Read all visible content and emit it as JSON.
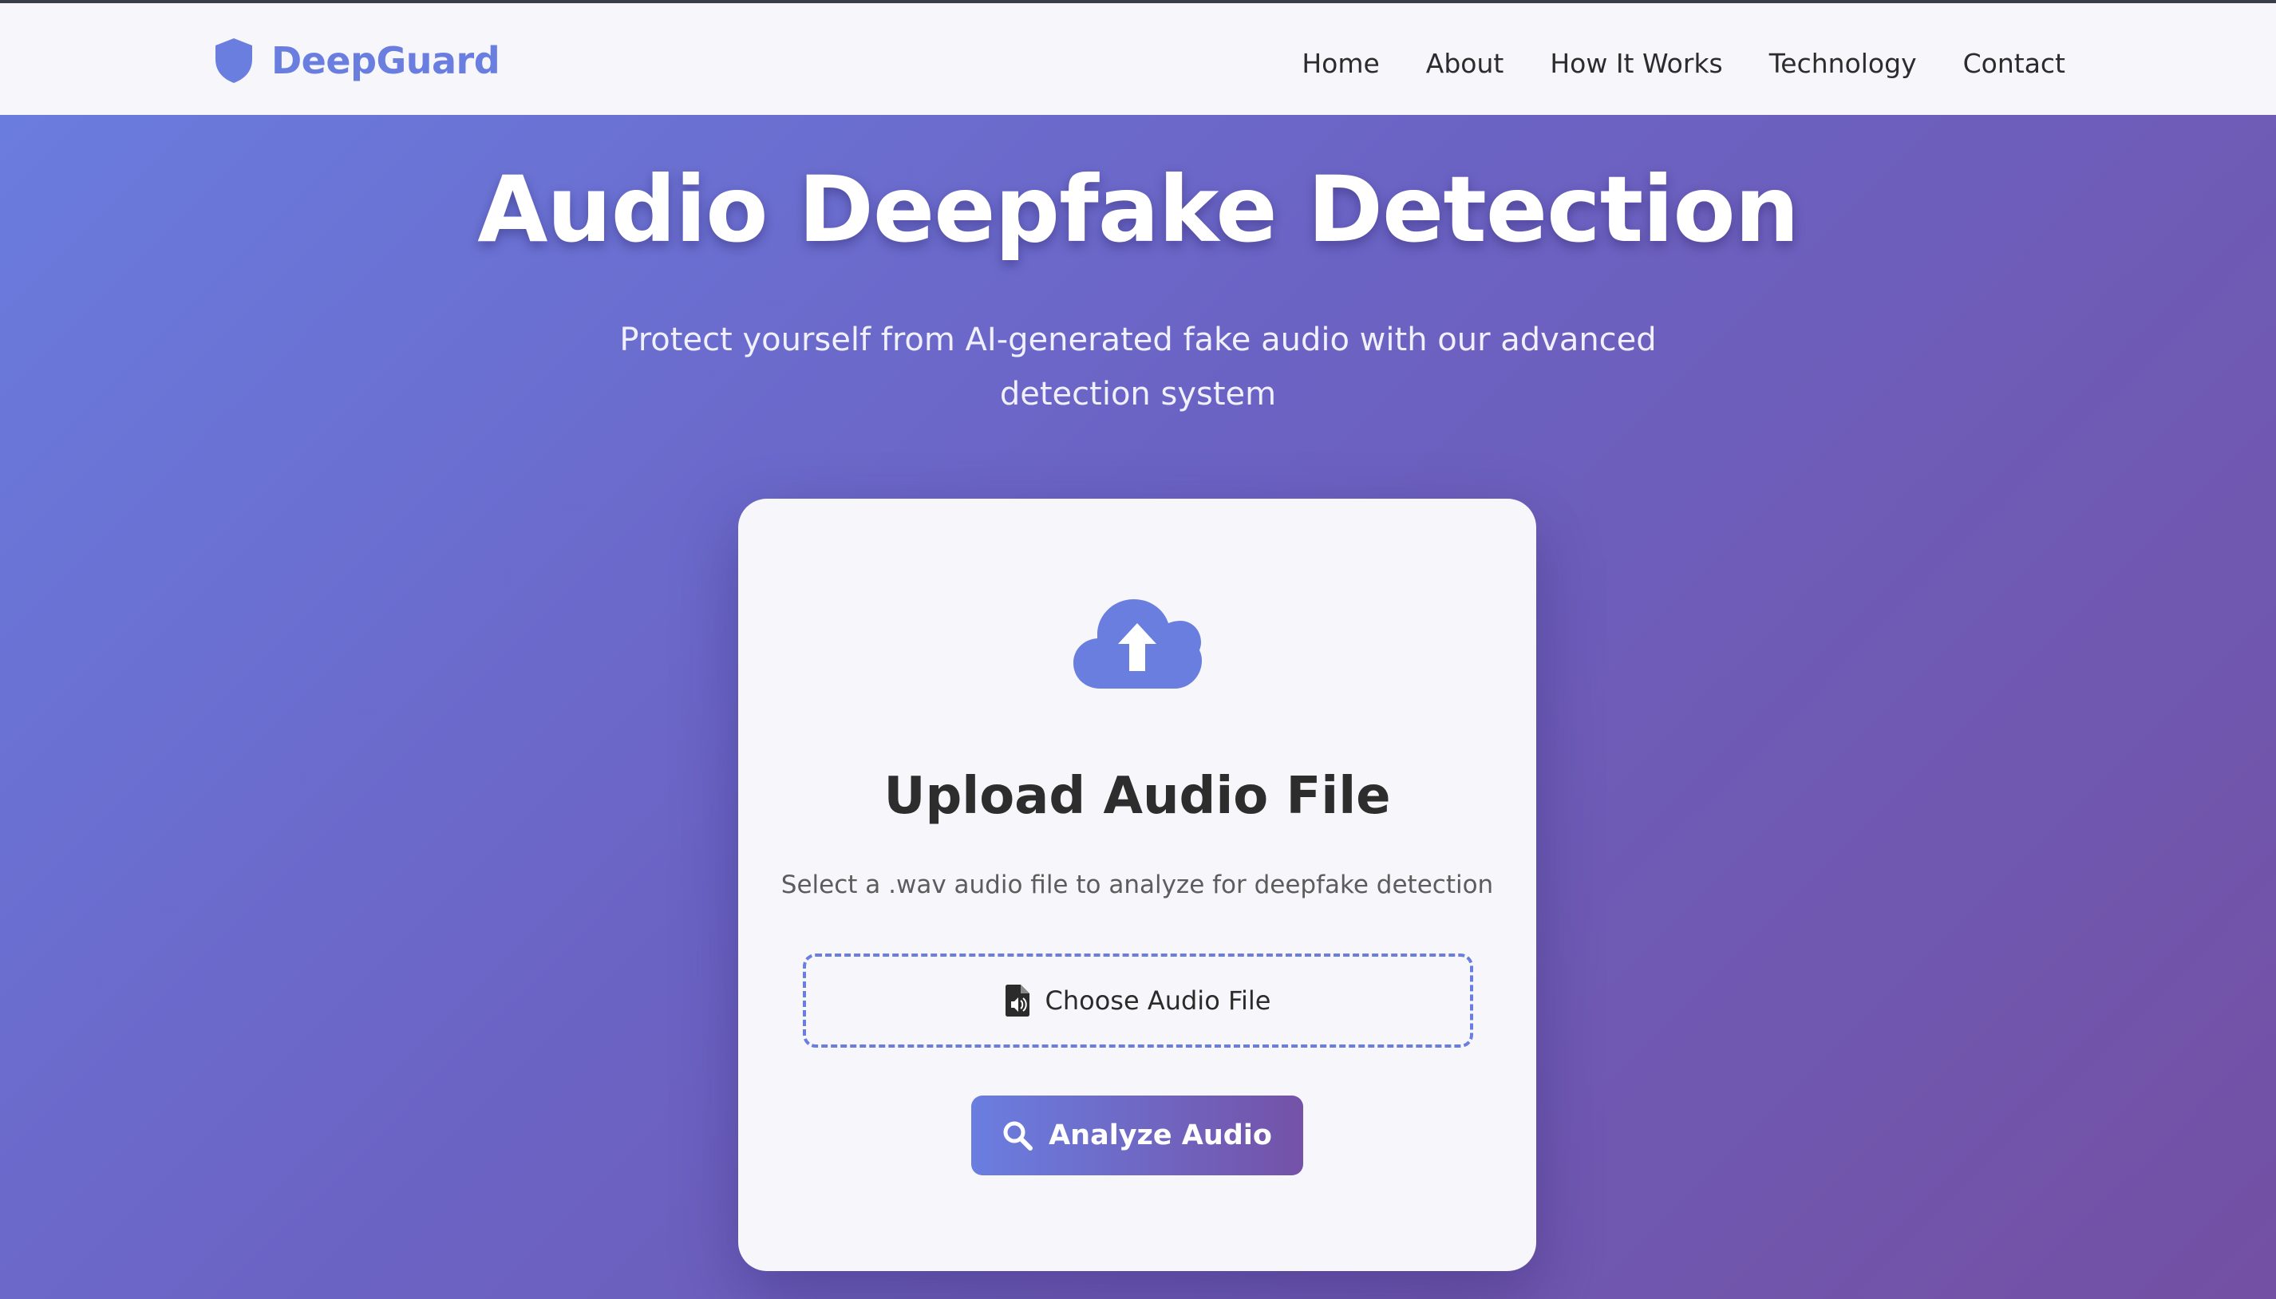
{
  "brand": {
    "name": "DeepGuard",
    "icon": "shield-icon",
    "color": "#6a7ee0"
  },
  "nav": {
    "items": [
      {
        "label": "Home"
      },
      {
        "label": "About"
      },
      {
        "label": "How It Works"
      },
      {
        "label": "Technology"
      },
      {
        "label": "Contact"
      }
    ]
  },
  "hero": {
    "title": "Audio Deepfake Detection",
    "subtitle_line1": "Protect yourself from AI-generated fake audio with our advanced",
    "subtitle_line2": "detection system"
  },
  "upload": {
    "icon": "cloud-upload-icon",
    "title": "Upload Audio File",
    "description": "Select a .wav audio file to analyze for deepfake detection",
    "file_button_icon": "audio-file-icon",
    "file_button_label": "Choose Audio File",
    "analyze_icon": "search-icon",
    "analyze_label": "Analyze Audio"
  },
  "colors": {
    "accent": "#6a7ee0",
    "gradient_start": "#6a7ee0",
    "gradient_end": "#7452a8",
    "card_bg": "#f7f7fb",
    "nav_bg": "#f7f7fb"
  }
}
